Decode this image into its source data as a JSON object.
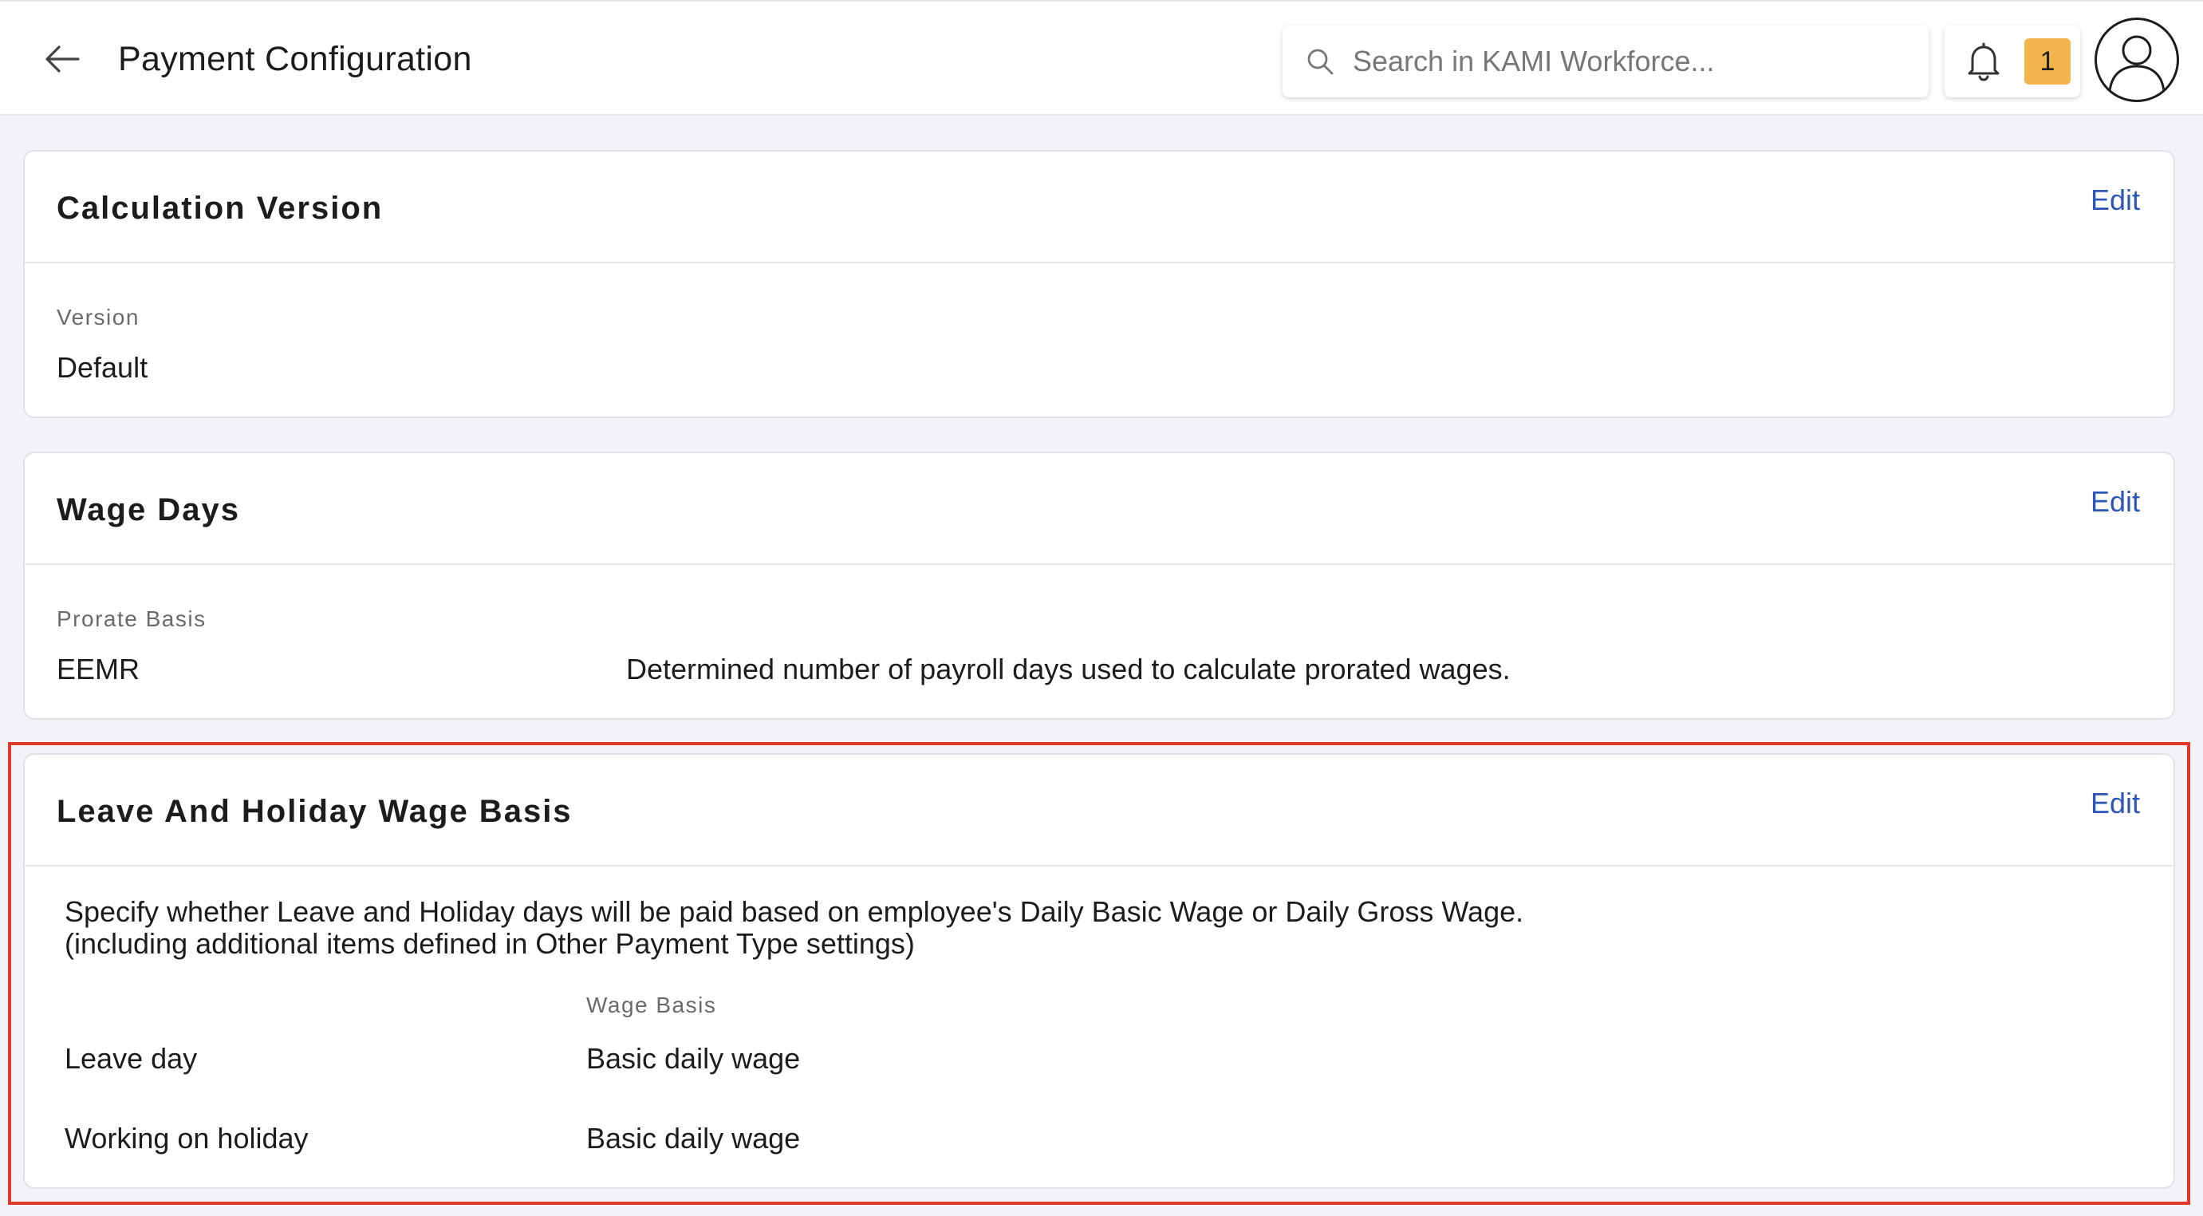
{
  "header": {
    "title": "Payment Configuration",
    "search_placeholder": "Search in KAMI Workforce...",
    "notification_count": "1"
  },
  "cards": {
    "calculation": {
      "title": "Calculation Version",
      "edit_label": "Edit",
      "version_label": "Version",
      "version_value": "Default"
    },
    "wage_days": {
      "title": "Wage Days",
      "edit_label": "Edit",
      "prorate_label": "Prorate Basis",
      "prorate_value": "EEMR",
      "prorate_description": "Determined number of payroll days used to calculate prorated wages."
    },
    "leave_holiday": {
      "title": "Leave And Holiday Wage Basis",
      "edit_label": "Edit",
      "description_line1": "Specify whether Leave and Holiday days will be paid based on employee's Daily Basic Wage or Daily Gross Wage.",
      "description_line2": "(including additional items defined in Other Payment Type settings)",
      "column_header": "Wage Basis",
      "rows": [
        {
          "label": "Leave day",
          "value": "Basic daily wage"
        },
        {
          "label": "Working on holiday",
          "value": "Basic daily wage"
        }
      ]
    }
  },
  "colors": {
    "accent": "#2c57b8",
    "badge": "#f2b54b",
    "highlight": "#e0392b",
    "background": "#f1f3f6"
  },
  "icons": {
    "back": "arrow-left-icon",
    "search": "search-icon",
    "bell": "bell-icon",
    "avatar": "user-avatar-icon"
  }
}
